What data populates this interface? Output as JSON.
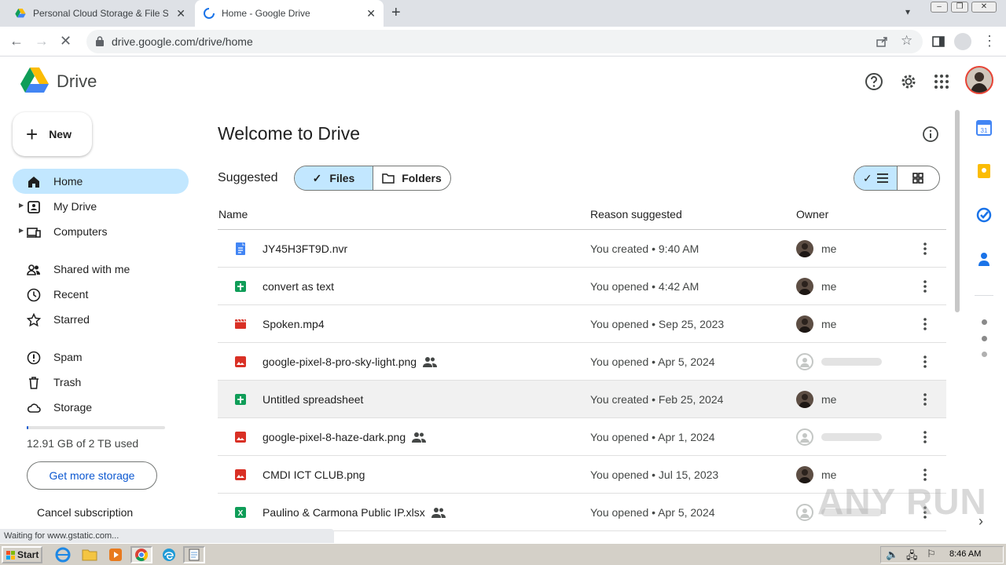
{
  "browser": {
    "tabs": [
      {
        "title": "Personal Cloud Storage & File Sharing",
        "active": false
      },
      {
        "title": "Home - Google Drive",
        "active": true
      }
    ],
    "new_tab": "+",
    "url": "drive.google.com/drive/home",
    "status_text": "Waiting for www.gstatic.com..."
  },
  "header": {
    "brand": "Drive"
  },
  "sidebar": {
    "new_label": "New",
    "items": [
      {
        "label": "Home",
        "icon": "home-icon",
        "active": true
      },
      {
        "label": "My Drive",
        "icon": "my-drive-icon"
      },
      {
        "label": "Computers",
        "icon": "computers-icon"
      },
      {
        "label": "Shared with me",
        "icon": "people-icon"
      },
      {
        "label": "Recent",
        "icon": "clock-icon"
      },
      {
        "label": "Starred",
        "icon": "star-icon"
      },
      {
        "label": "Spam",
        "icon": "spam-icon"
      },
      {
        "label": "Trash",
        "icon": "trash-icon"
      },
      {
        "label": "Storage",
        "icon": "cloud-icon"
      }
    ],
    "storage_used_fraction": 0.0065,
    "storage_text": "12.91 GB of 2 TB used",
    "get_more": "Get more storage",
    "cancel": "Cancel subscription"
  },
  "main": {
    "title": "Welcome to Drive",
    "suggested": "Suggested",
    "chip_files": "Files",
    "chip_folders": "Folders",
    "columns": {
      "name": "Name",
      "reason": "Reason suggested",
      "owner": "Owner"
    },
    "rows": [
      {
        "name": "JY45H3FT9D.nvr",
        "type": "doc",
        "shared": false,
        "reason": "You created • 9:40 AM",
        "owner": "me"
      },
      {
        "name": "convert as text",
        "type": "sheet",
        "shared": false,
        "reason": "You opened • 4:42 AM",
        "owner": "me"
      },
      {
        "name": "Spoken.mp4",
        "type": "video",
        "shared": false,
        "reason": "You opened • Sep 25, 2023",
        "owner": "me"
      },
      {
        "name": "google-pixel-8-pro-sky-light.png",
        "type": "image",
        "shared": true,
        "reason": "You opened • Apr 5, 2024",
        "owner": ""
      },
      {
        "name": "Untitled spreadsheet",
        "type": "sheet",
        "shared": false,
        "reason": "You created • Feb 25, 2024",
        "owner": "me"
      },
      {
        "name": "google-pixel-8-haze-dark.png",
        "type": "image",
        "shared": true,
        "reason": "You opened • Apr 1, 2024",
        "owner": ""
      },
      {
        "name": "CMDI ICT CLUB.png",
        "type": "image",
        "shared": false,
        "reason": "You opened • Jul 15, 2023",
        "owner": "me"
      },
      {
        "name": "Paulino & Carmona Public IP.xlsx",
        "type": "excel",
        "shared": true,
        "reason": "You opened • Apr 5, 2024",
        "owner": ""
      }
    ]
  },
  "watermark": "ANY RUN",
  "taskbar": {
    "start": "Start",
    "clock": "8:46 AM"
  },
  "colors": {
    "accent": "#0b57d0",
    "active_bg": "#c2e7ff",
    "doc": "#4285f4",
    "sheet": "#0f9d58",
    "media": "#d93025"
  }
}
